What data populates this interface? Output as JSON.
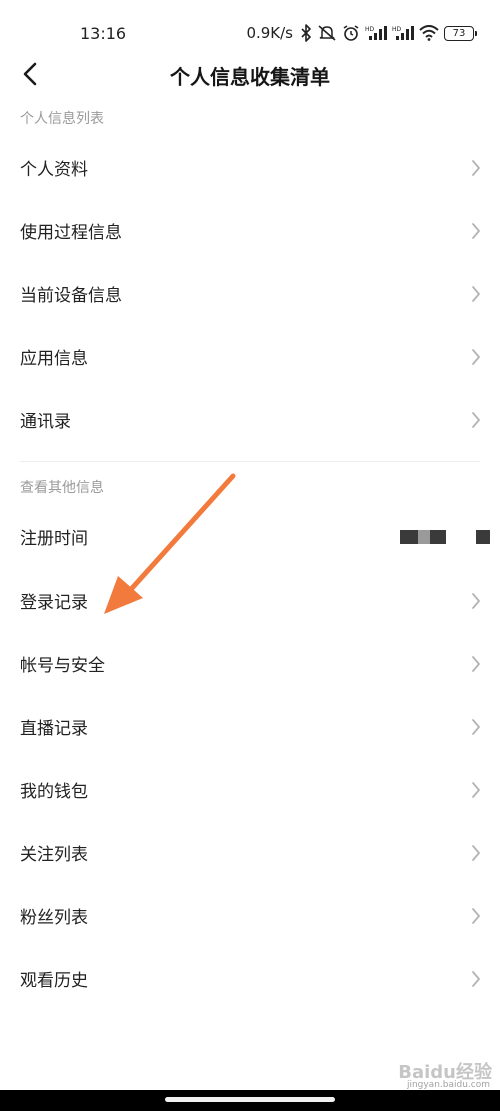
{
  "status_bar": {
    "time": "13:16",
    "net_speed": "0.9K/s",
    "battery": "73",
    "icons": [
      "bluetooth-icon",
      "mute-icon",
      "alarm-icon",
      "signal-hd-icon",
      "signal-hd-icon",
      "wifi-icon",
      "battery-icon"
    ]
  },
  "nav": {
    "title": "个人信息收集清单",
    "back_icon": "back-chevron-icon"
  },
  "sections": [
    {
      "header": "个人信息列表",
      "items": [
        {
          "label": "个人资料"
        },
        {
          "label": "使用过程信息"
        },
        {
          "label": "当前设备信息"
        },
        {
          "label": "应用信息"
        },
        {
          "label": "通讯录"
        }
      ]
    },
    {
      "header": "查看其他信息",
      "items": [
        {
          "label": "注册时间"
        },
        {
          "label": "登录记录"
        },
        {
          "label": "帐号与安全"
        },
        {
          "label": "直播记录"
        },
        {
          "label": "我的钱包"
        },
        {
          "label": "关注列表"
        },
        {
          "label": "粉丝列表"
        },
        {
          "label": "观看历史"
        }
      ]
    }
  ],
  "colors": {
    "accent_arrow": "#f27a3c",
    "section_header": "#9a9a9a",
    "chevron": "#b4b4b4"
  },
  "watermark": {
    "brand": "Baidu经验",
    "url": "jingyan.baidu.com"
  }
}
